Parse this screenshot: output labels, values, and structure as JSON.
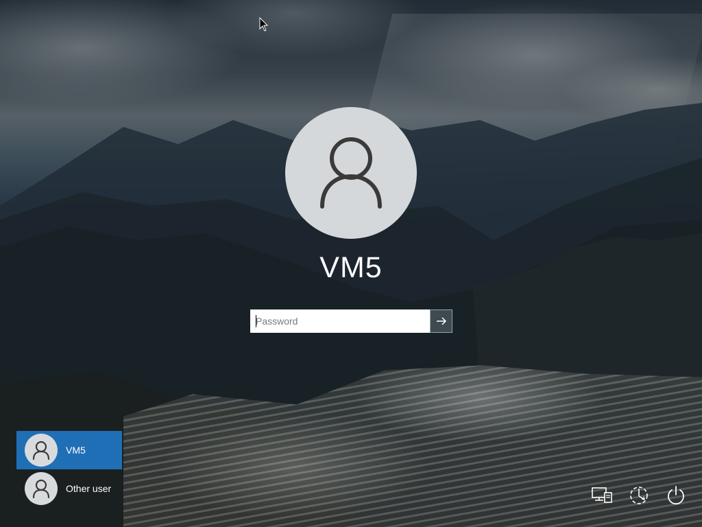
{
  "lockscreen": {
    "username": "VM5",
    "password": {
      "placeholder": "Password",
      "value": ""
    }
  },
  "user_list": [
    {
      "label": "VM5",
      "selected": true
    },
    {
      "label": "Other user",
      "selected": false
    }
  ],
  "system_icons": [
    "network-icon",
    "accessibility-icon",
    "power-icon"
  ],
  "colors": {
    "selected_user_bg": "#1f6fb6",
    "avatar_bg": "#d5d8da",
    "avatar_glyph": "#3a3a3a"
  }
}
